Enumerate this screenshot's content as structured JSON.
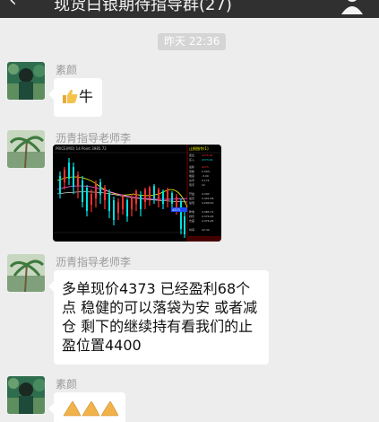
{
  "header": {
    "back_icon": "chevron-left-icon",
    "title": "现货白银期待指导群(27)",
    "menu_icon": "person-icon"
  },
  "timestamp": "昨天 22:36",
  "messages": [
    {
      "sender": "素颜",
      "text": "牛",
      "emoji": "thumbs-up"
    },
    {
      "sender": "沥青指导老师李",
      "type": "image"
    },
    {
      "sender": "沥青指导老师李",
      "text": "多单现价4373   已经盈利68个点   稳健的可以落袋为安 或者减仓   剩下的继续持有看我们的止盈位置4400"
    },
    {
      "sender": "素颜",
      "emoji": "praying-hands x3"
    }
  ],
  "chart_image": {
    "header_text": "PRICE(MO) 14 Point 3985.72",
    "side_header": "止损指令(1) 实盘",
    "last_price": "4373",
    "colors": {
      "up": "#00e0e0",
      "down": "#ff3030",
      "ma": "#ffff00"
    }
  }
}
